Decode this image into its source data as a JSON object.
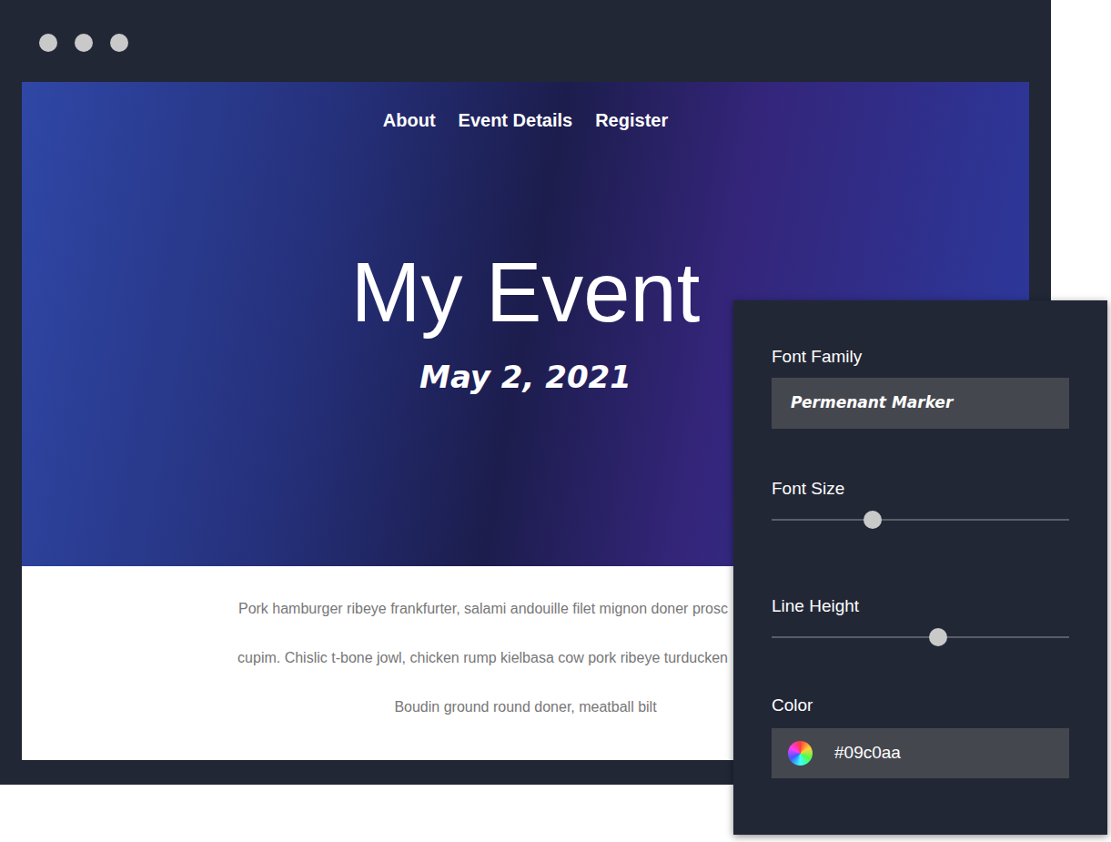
{
  "nav": [
    {
      "label": "About"
    },
    {
      "label": "Event Details"
    },
    {
      "label": "Register"
    }
  ],
  "hero": {
    "title": "My Event",
    "date": "May 2, 2021"
  },
  "body_text": [
    "Pork hamburger ribeye frankfurter, salami andouille filet mignon doner prosc",
    "cupim. Chislic t-bone jowl, chicken rump kielbasa cow pork ribeye turducken",
    "Boudin ground round doner, meatball bilt"
  ],
  "panel": {
    "font_family": {
      "label": "Font Family",
      "value": "Permenant Marker"
    },
    "font_size": {
      "label": "Font Size",
      "level": 0.34
    },
    "line_height": {
      "label": "Line Height",
      "level": 0.56
    },
    "color": {
      "label": "Color",
      "value": "#09c0aa"
    }
  }
}
